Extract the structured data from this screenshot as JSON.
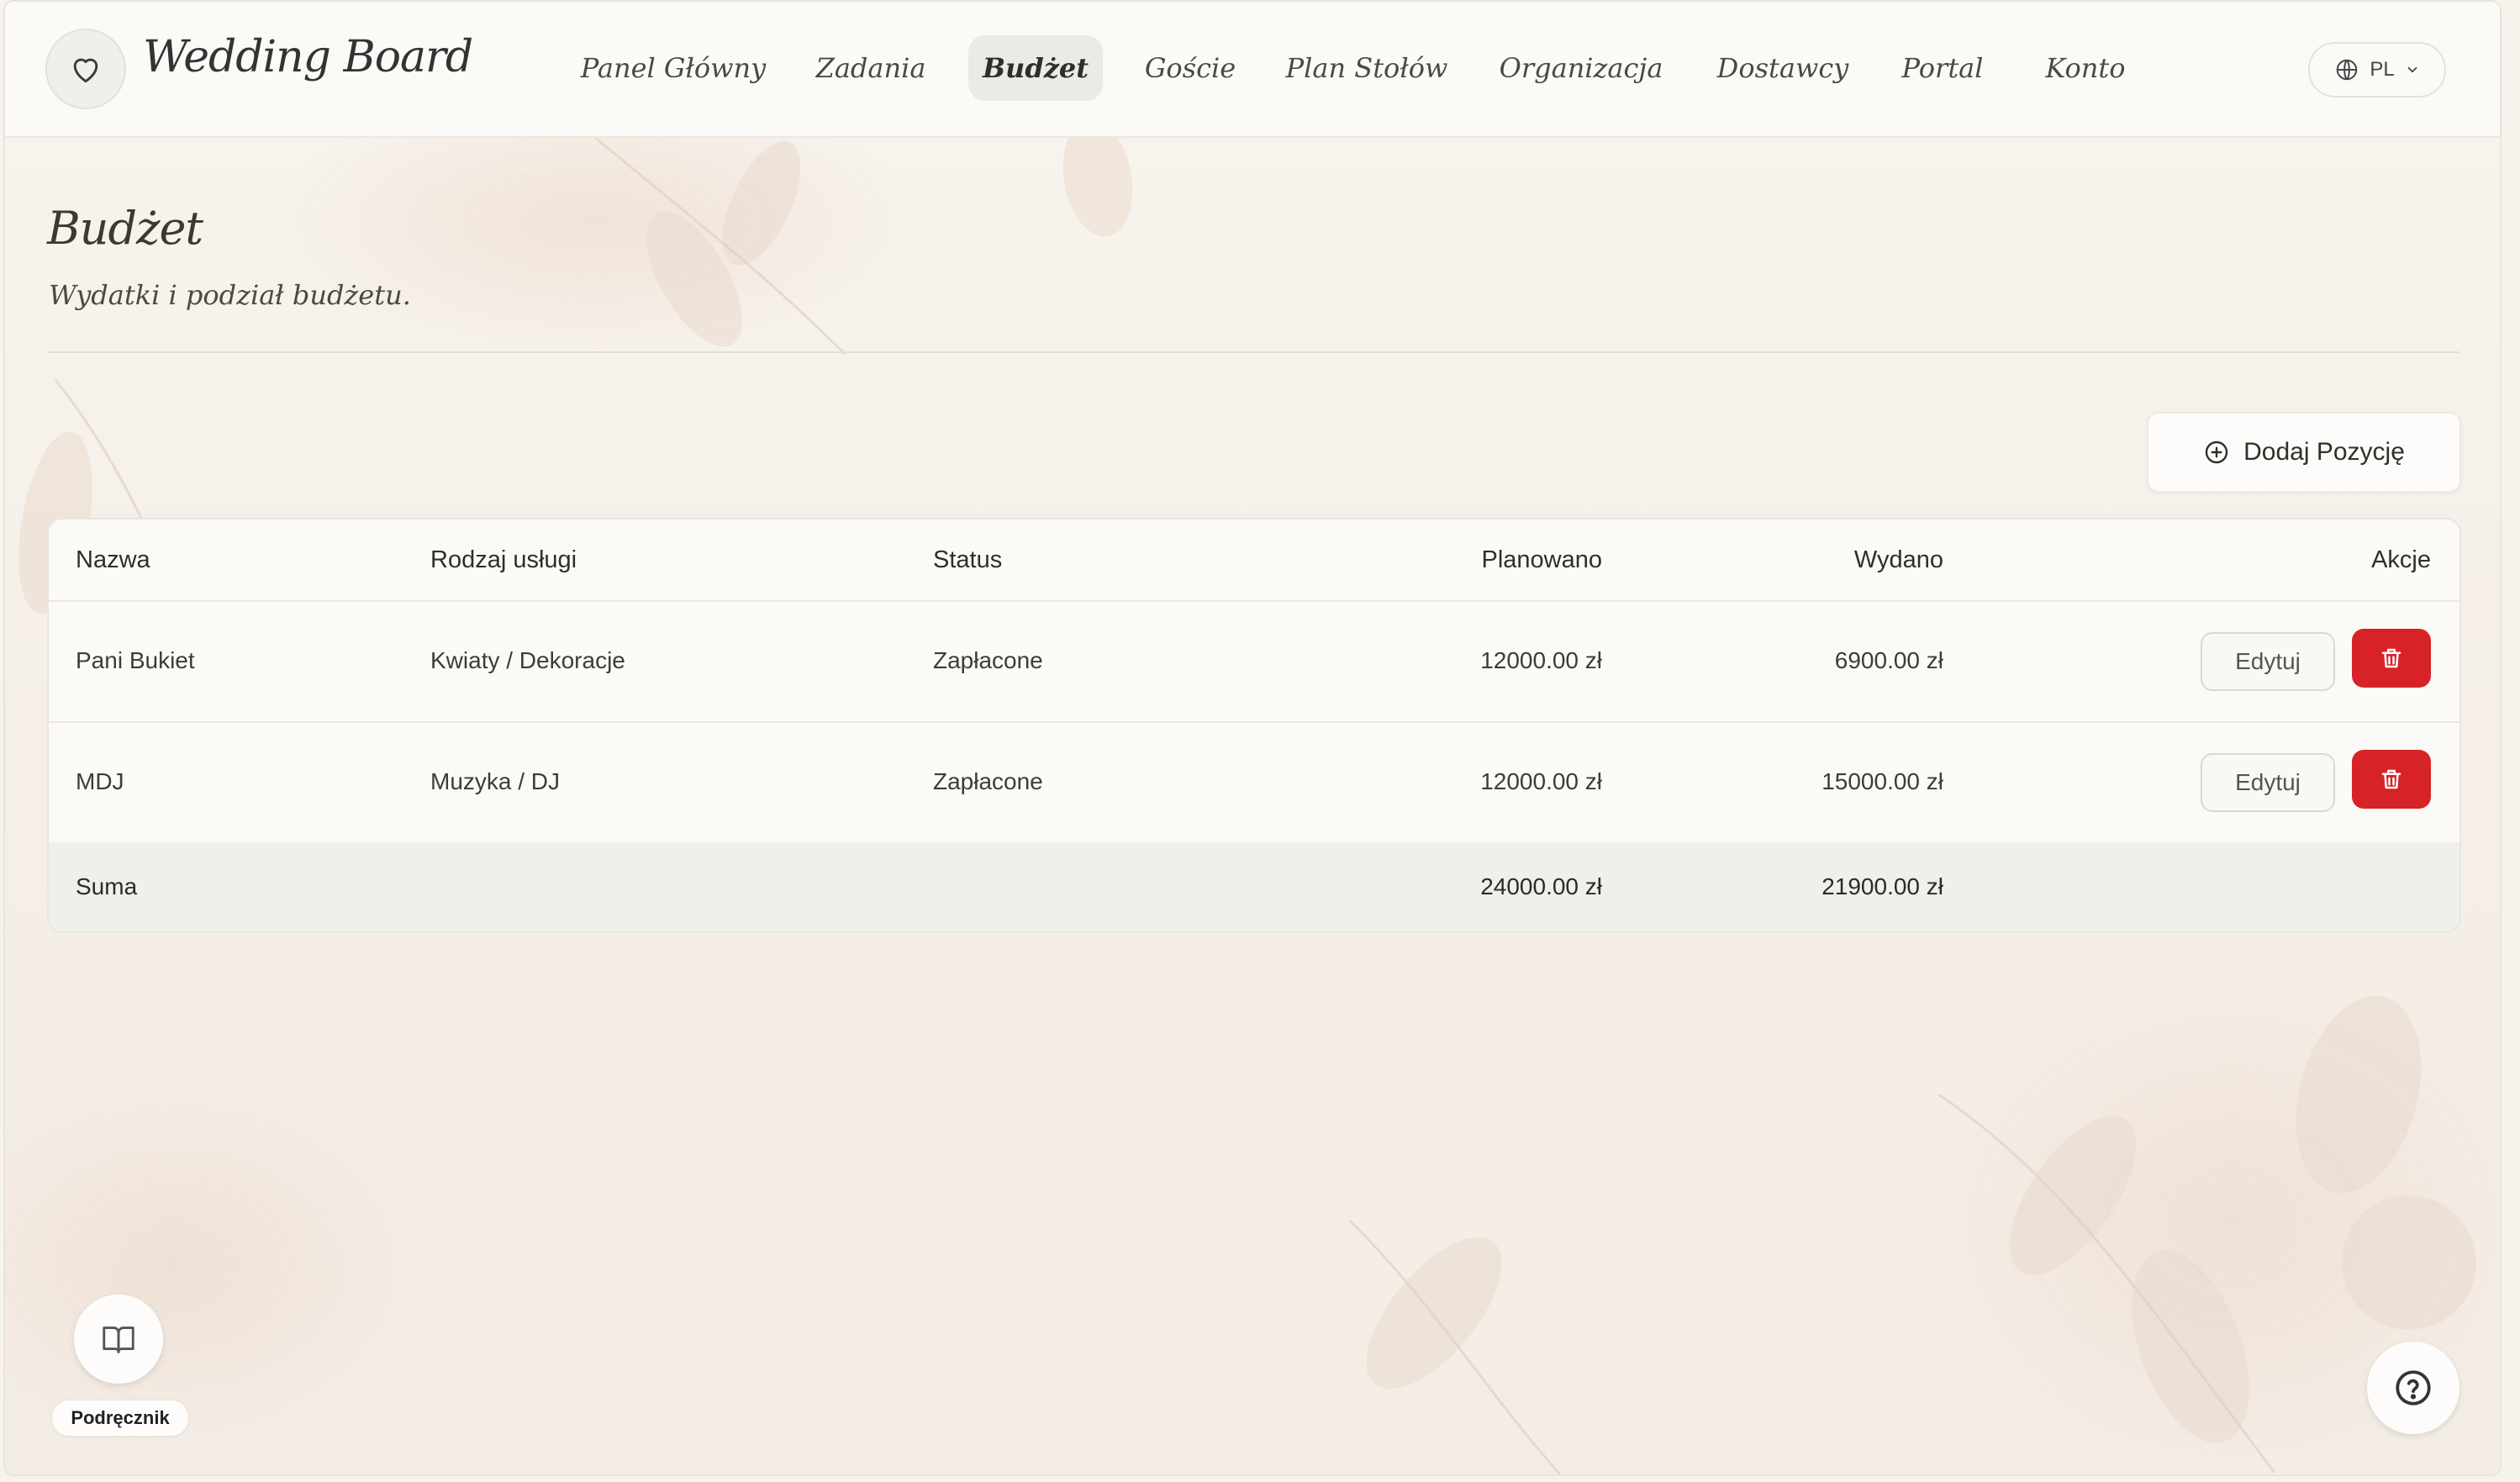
{
  "app": {
    "logo_text": "Wedding Board"
  },
  "nav": {
    "items": [
      {
        "label": "Panel Główny"
      },
      {
        "label": "Zadania"
      },
      {
        "label": "Budżet"
      },
      {
        "label": "Goście"
      },
      {
        "label": "Plan Stołów"
      },
      {
        "label": "Organizacja"
      },
      {
        "label": "Dostawcy"
      },
      {
        "label": "Portal"
      },
      {
        "label": "Konto"
      }
    ],
    "active_index": 2
  },
  "lang": {
    "code": "PL",
    "icon": "globe-icon"
  },
  "page": {
    "title": "Budżet",
    "subtitle": "Wydatki i podział budżetu."
  },
  "toolbar": {
    "add_label": "Dodaj Pozycję",
    "add_icon": "plus-circle-icon"
  },
  "table": {
    "headers": [
      "Nazwa",
      "Rodzaj usługi",
      "Status",
      "Planowano",
      "Wydano",
      "Akcje"
    ],
    "rows": [
      {
        "name": "Pani Bukiet",
        "service": "Kwiaty / Dekoracje",
        "status": "Zapłacone",
        "planned": "12000.00 zł",
        "spent": "6900.00 zł",
        "edit_label": "Edytuj"
      },
      {
        "name": "MDJ",
        "service": "Muzyka / DJ",
        "status": "Zapłacone",
        "planned": "12000.00 zł",
        "spent": "15000.00 zł",
        "edit_label": "Edytuj"
      }
    ],
    "total": {
      "label": "Suma",
      "planned": "24000.00 zł",
      "spent": "21900.00 zł"
    }
  },
  "handbook": {
    "label": "Podręcznik",
    "icon": "book-icon"
  },
  "help": {
    "icon": "help-circle-icon"
  },
  "colors": {
    "delete": "#d72327",
    "active_nav_bg": "#ebeae4",
    "background": "#f6f2ec"
  }
}
